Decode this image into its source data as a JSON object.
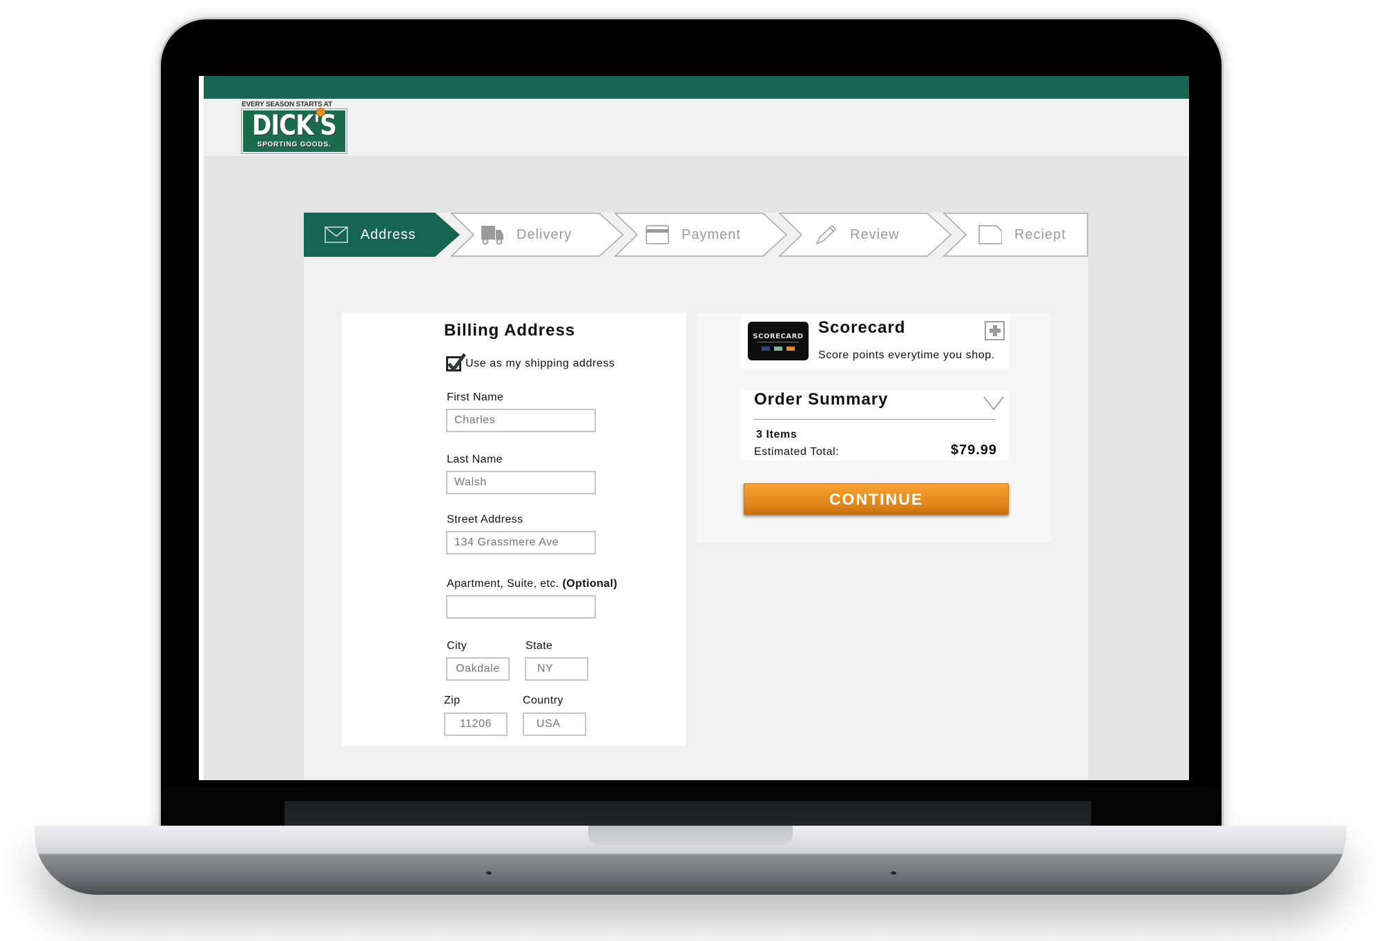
{
  "brand": {
    "tagline": "EVERY SEASON STARTS AT",
    "name": "DICK'S",
    "subname": "SPORTING GOODS.",
    "primary_color": "#166452",
    "accent_color": "#e48a1e"
  },
  "stepper": {
    "steps": [
      {
        "label": "Address",
        "icon": "envelope-icon",
        "active": true
      },
      {
        "label": "Delivery",
        "icon": "truck-icon",
        "active": false
      },
      {
        "label": "Payment",
        "icon": "credit-card-icon",
        "active": false
      },
      {
        "label": "Review",
        "icon": "pencil-icon",
        "active": false
      },
      {
        "label": "Reciept",
        "icon": "document-icon",
        "active": false
      }
    ]
  },
  "billing": {
    "title": "Billing Address",
    "use_as_shipping_label": "Use as my shipping address",
    "use_as_shipping_checked": true,
    "fields": {
      "first_name": {
        "label": "First Name",
        "placeholder": "Charles"
      },
      "last_name": {
        "label": "Last Name",
        "placeholder": "Walsh"
      },
      "street": {
        "label": "Street Address",
        "placeholder": "134 Grassmere Ave"
      },
      "apartment": {
        "label": "Apartment, Suite, etc.",
        "label_suffix": "(Optional)",
        "placeholder": ""
      },
      "city": {
        "label": "City",
        "placeholder": "Oakdale"
      },
      "state": {
        "label": "State",
        "placeholder": "NY"
      },
      "zip": {
        "label": "Zip",
        "placeholder": "11206"
      },
      "country": {
        "label": "Country",
        "placeholder": "USA"
      }
    }
  },
  "scorecard": {
    "card_text": "SCORECARD",
    "title": "Scorecard",
    "description": "Score points everytime you shop.",
    "add_icon": "plus-icon"
  },
  "order_summary": {
    "title": "Order Summary",
    "toggle_icon": "chevron-down-icon",
    "items": "3 Items",
    "total_label": "Estimated Total:",
    "total_value": "$79.99"
  },
  "actions": {
    "continue_label": "CONTINUE"
  }
}
